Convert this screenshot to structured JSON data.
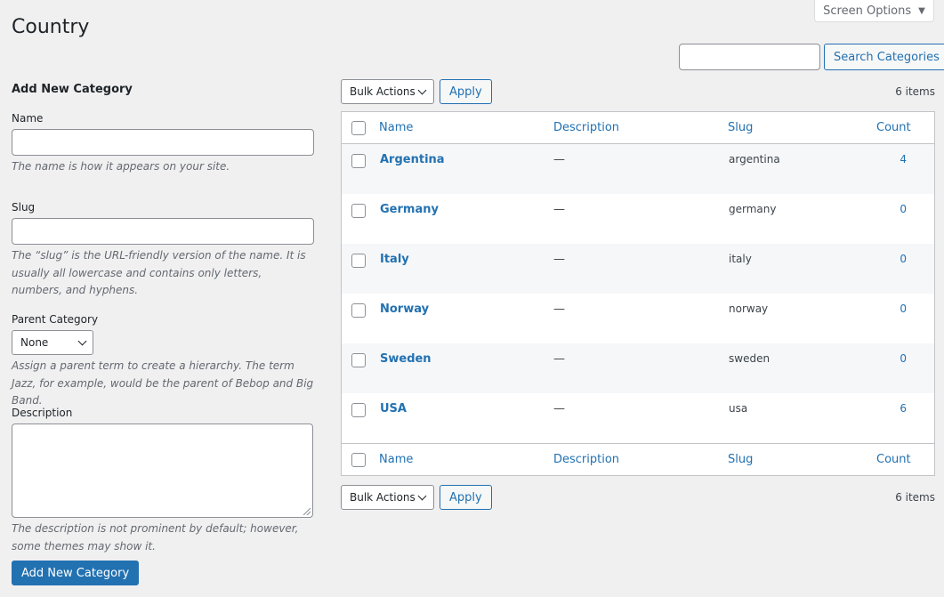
{
  "screen_options": {
    "label": "Screen Options",
    "icon": "triangle-down-icon"
  },
  "page_title": "Country",
  "search": {
    "value": "",
    "button_label": "Search Categories"
  },
  "form": {
    "heading": "Add New Category",
    "name": {
      "label": "Name",
      "value": "",
      "help": "The name is how it appears on your site."
    },
    "slug": {
      "label": "Slug",
      "value": "",
      "help": "The “slug” is the URL-friendly version of the name. It is usually all lowercase and contains only letters, numbers, and hyphens."
    },
    "parent": {
      "label": "Parent Category",
      "selected": "None",
      "help": "Assign a parent term to create a hierarchy. The term Jazz, for example, would be the parent of Bebop and Big Band."
    },
    "description": {
      "label": "Description",
      "value": "",
      "help": "The description is not prominent by default; however, some themes may show it."
    },
    "submit_label": "Add New Category"
  },
  "tablenav_top": {
    "bulk_selected": "Bulk Actions",
    "apply_label": "Apply",
    "items_count": "6 items"
  },
  "tablenav_bottom": {
    "bulk_selected": "Bulk Actions",
    "apply_label": "Apply",
    "items_count": "6 items"
  },
  "table": {
    "columns": {
      "name": "Name",
      "description": "Description",
      "slug": "Slug",
      "count": "Count"
    },
    "rows": [
      {
        "name": "Argentina",
        "description": "—",
        "slug": "argentina",
        "count": "4"
      },
      {
        "name": "Germany",
        "description": "—",
        "slug": "germany",
        "count": "0"
      },
      {
        "name": "Italy",
        "description": "—",
        "slug": "italy",
        "count": "0"
      },
      {
        "name": "Norway",
        "description": "—",
        "slug": "norway",
        "count": "0"
      },
      {
        "name": "Sweden",
        "description": "—",
        "slug": "sweden",
        "count": "0"
      },
      {
        "name": "USA",
        "description": "—",
        "slug": "usa",
        "count": "6"
      }
    ]
  }
}
